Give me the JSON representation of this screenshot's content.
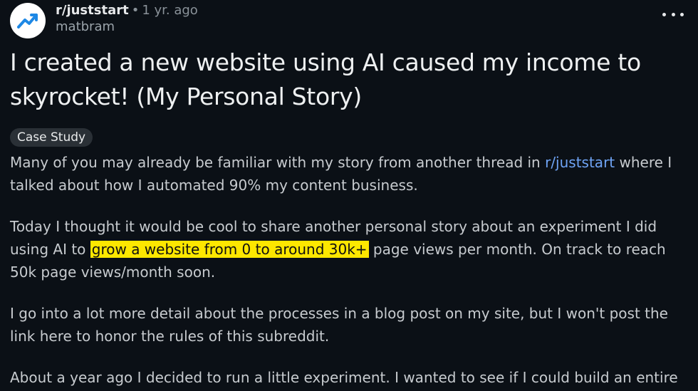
{
  "header": {
    "avatar_icon": "trending-up-icon",
    "subreddit": "r/juststart",
    "separator": "•",
    "time": "1 yr. ago",
    "author": "matbram",
    "more_icon": "more-horizontal-icon"
  },
  "post": {
    "title": "I created a new website using AI caused my income to skyrocket! (My Personal Story)",
    "flair": "Case Study",
    "p1_before": "Many of you may already be familiar with my story from another thread in ",
    "p1_link": "r/juststart",
    "p1_after": " where I talked about how I automated 90% my content business.",
    "p2_before": "Today I thought it would be cool to share another personal story about an experiment I did using AI to ",
    "p2_highlight": "grow a website from 0 to around 30k+",
    "p2_after": " page views per month. On track to reach 50k page views/month soon.",
    "p3": "I go into a lot more detail about the processes in a blog post on my site, but I won't post the link here to honor the rules of this subreddit.",
    "p4": "About a year ago I decided to run a little experiment. I wanted to see if I could build an entire"
  },
  "colors": {
    "background": "#0b1016",
    "link": "#6fa4f5",
    "highlight": "#fde700",
    "avatar_accent": "#1e88e5"
  }
}
